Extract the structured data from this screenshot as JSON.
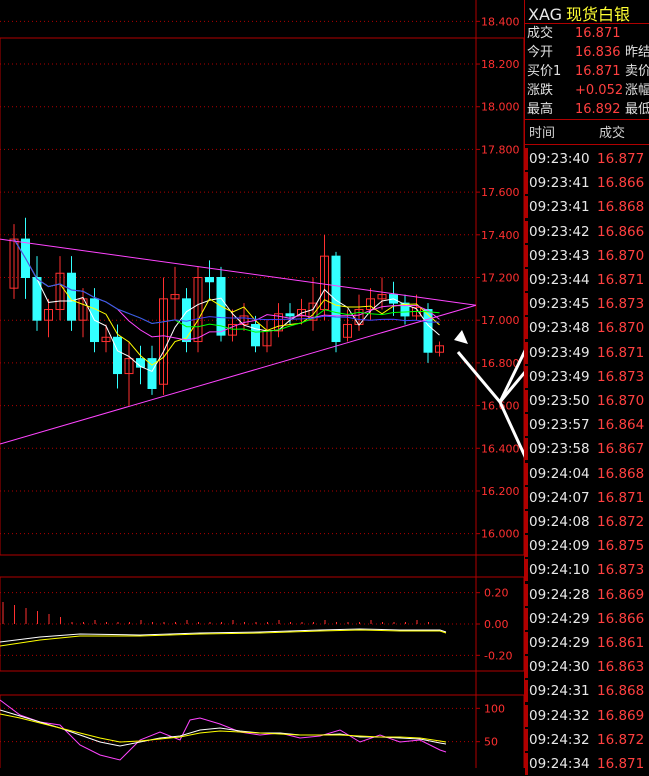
{
  "header": {
    "code": "XAG",
    "name": "现货白银"
  },
  "quote": [
    {
      "label": "成交",
      "value": "16.871",
      "label2": ""
    },
    {
      "label": "今开",
      "value": "16.836",
      "label2": "昨结"
    },
    {
      "label": "买价1",
      "value": "16.871",
      "label2": "卖价"
    },
    {
      "label": "涨跌",
      "value": "+0.052",
      "label2": "涨幅"
    },
    {
      "label": "最高",
      "value": "16.892",
      "label2": "最低"
    }
  ],
  "ticks_header": {
    "time": "时间",
    "price": "成交"
  },
  "ticks": [
    {
      "time": "09:23:40",
      "price": "16.877"
    },
    {
      "time": "09:23:41",
      "price": "16.866"
    },
    {
      "time": "09:23:41",
      "price": "16.868"
    },
    {
      "time": "09:23:42",
      "price": "16.866"
    },
    {
      "time": "09:23:43",
      "price": "16.870"
    },
    {
      "time": "09:23:44",
      "price": "16.871"
    },
    {
      "time": "09:23:45",
      "price": "16.873"
    },
    {
      "time": "09:23:48",
      "price": "16.870"
    },
    {
      "time": "09:23:49",
      "price": "16.871"
    },
    {
      "time": "09:23:49",
      "price": "16.873"
    },
    {
      "time": "09:23:50",
      "price": "16.870"
    },
    {
      "time": "09:23:57",
      "price": "16.864"
    },
    {
      "time": "09:23:58",
      "price": "16.867"
    },
    {
      "time": "09:24:04",
      "price": "16.868"
    },
    {
      "time": "09:24:07",
      "price": "16.871"
    },
    {
      "time": "09:24:08",
      "price": "16.872"
    },
    {
      "time": "09:24:09",
      "price": "16.875"
    },
    {
      "time": "09:24:10",
      "price": "16.873"
    },
    {
      "time": "09:24:28",
      "price": "16.869"
    },
    {
      "time": "09:24:29",
      "price": "16.866"
    },
    {
      "time": "09:24:29",
      "price": "16.861"
    },
    {
      "time": "09:24:30",
      "price": "16.863"
    },
    {
      "time": "09:24:31",
      "price": "16.868"
    },
    {
      "time": "09:24:32",
      "price": "16.869"
    },
    {
      "time": "09:24:32",
      "price": "16.872"
    },
    {
      "time": "09:24:34",
      "price": "16.871"
    }
  ],
  "colors": {
    "up": "#ff3030",
    "down": "#33ffff",
    "grid": "#b00000",
    "axis_text": "#ff3030",
    "trend": "#ff44ff",
    "ma1": "#ffffff",
    "ma2": "#ffff00",
    "ma3": "#ff44ff",
    "ma4": "#00ff00",
    "ma5": "#4444ff"
  },
  "chart_data": [
    {
      "type": "candlestick",
      "panel": "price",
      "ylim": [
        15.9,
        18.5
      ],
      "y_ticks": [
        "18.400",
        "18.200",
        "18.000",
        "17.800",
        "17.600",
        "17.400",
        "17.200",
        "17.000",
        "16.800",
        "16.600",
        "16.400",
        "16.200",
        "16.000"
      ],
      "candles": [
        {
          "o": 17.15,
          "c": 17.38,
          "h": 17.45,
          "l": 17.1
        },
        {
          "o": 17.38,
          "c": 17.2,
          "h": 17.48,
          "l": 17.1
        },
        {
          "o": 17.2,
          "c": 17.0,
          "h": 17.3,
          "l": 16.95
        },
        {
          "o": 17.0,
          "c": 17.05,
          "h": 17.1,
          "l": 16.92
        },
        {
          "o": 17.05,
          "c": 17.22,
          "h": 17.3,
          "l": 17.0
        },
        {
          "o": 17.22,
          "c": 17.0,
          "h": 17.3,
          "l": 16.95
        },
        {
          "o": 17.0,
          "c": 17.1,
          "h": 17.15,
          "l": 16.92
        },
        {
          "o": 17.1,
          "c": 16.9,
          "h": 17.15,
          "l": 16.85
        },
        {
          "o": 16.9,
          "c": 16.92,
          "h": 16.98,
          "l": 16.85
        },
        {
          "o": 16.92,
          "c": 16.75,
          "h": 16.98,
          "l": 16.68
        },
        {
          "o": 16.75,
          "c": 16.82,
          "h": 16.9,
          "l": 16.6
        },
        {
          "o": 16.82,
          "c": 16.78,
          "h": 16.88,
          "l": 16.7
        },
        {
          "o": 16.82,
          "c": 16.68,
          "h": 16.88,
          "l": 16.65
        },
        {
          "o": 16.7,
          "c": 17.1,
          "h": 17.2,
          "l": 16.65
        },
        {
          "o": 17.1,
          "c": 17.12,
          "h": 17.25,
          "l": 17.0
        },
        {
          "o": 17.1,
          "c": 16.9,
          "h": 17.15,
          "l": 16.85
        },
        {
          "o": 16.9,
          "c": 17.2,
          "h": 17.25,
          "l": 16.85
        },
        {
          "o": 17.2,
          "c": 17.18,
          "h": 17.28,
          "l": 17.1
        },
        {
          "o": 17.2,
          "c": 16.93,
          "h": 17.25,
          "l": 16.9
        },
        {
          "o": 16.93,
          "c": 16.98,
          "h": 17.05,
          "l": 16.9
        },
        {
          "o": 16.98,
          "c": 17.02,
          "h": 17.08,
          "l": 16.95
        },
        {
          "o": 16.98,
          "c": 16.88,
          "h": 17.02,
          "l": 16.85
        },
        {
          "o": 16.88,
          "c": 16.95,
          "h": 17.0,
          "l": 16.85
        },
        {
          "o": 16.95,
          "c": 17.03,
          "h": 17.08,
          "l": 16.92
        },
        {
          "o": 17.03,
          "c": 17.02,
          "h": 17.08,
          "l": 16.98
        },
        {
          "o": 17.02,
          "c": 17.05,
          "h": 17.1,
          "l": 16.98
        },
        {
          "o": 17.0,
          "c": 17.08,
          "h": 17.2,
          "l": 16.95
        },
        {
          "o": 17.05,
          "c": 17.3,
          "h": 17.4,
          "l": 17.0
        },
        {
          "o": 17.3,
          "c": 16.9,
          "h": 17.32,
          "l": 16.85
        },
        {
          "o": 16.92,
          "c": 16.98,
          "h": 17.05,
          "l": 16.9
        },
        {
          "o": 16.98,
          "c": 17.05,
          "h": 17.12,
          "l": 16.95
        },
        {
          "o": 17.05,
          "c": 17.1,
          "h": 17.15,
          "l": 17.0
        },
        {
          "o": 17.1,
          "c": 17.12,
          "h": 17.2,
          "l": 17.05
        },
        {
          "o": 17.12,
          "c": 17.08,
          "h": 17.18,
          "l": 17.02
        },
        {
          "o": 17.08,
          "c": 17.02,
          "h": 17.12,
          "l": 16.98
        },
        {
          "o": 17.02,
          "c": 17.06,
          "h": 17.12,
          "l": 17.0
        },
        {
          "o": 17.05,
          "c": 16.85,
          "h": 17.08,
          "l": 16.8
        },
        {
          "o": 16.85,
          "c": 16.88,
          "h": 16.9,
          "l": 16.83
        }
      ]
    },
    {
      "type": "line",
      "panel": "macd",
      "ylim": [
        -0.3,
        0.3
      ],
      "y_ticks": [
        "0.20",
        "0.00",
        "-0.20"
      ]
    },
    {
      "type": "line",
      "panel": "kdj",
      "ylim": [
        0,
        120
      ],
      "y_ticks": [
        "100",
        "50",
        "0"
      ]
    }
  ]
}
